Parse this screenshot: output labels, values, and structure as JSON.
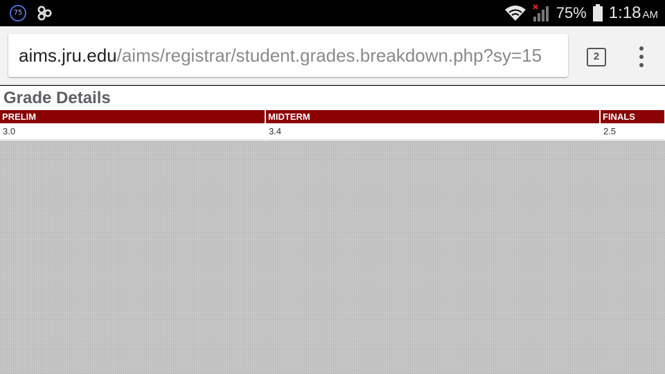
{
  "status_bar": {
    "notification_badge": "75",
    "battery_percent": "75%",
    "time": "1:18",
    "am_pm": "AM",
    "icons": [
      "notification-75-icon",
      "link-app-icon",
      "wifi-icon",
      "cellular-no-signal-icon",
      "battery-icon"
    ]
  },
  "browser": {
    "url_host": "aims.jru.edu",
    "url_path": "/aims/registrar/student.grades.breakdown.php?sy=15",
    "tab_count": "2"
  },
  "page": {
    "title": "Grade Details",
    "columns": [
      "PRELIM",
      "MIDTERM",
      "FINALS"
    ],
    "rows": [
      [
        "3.0",
        "3.4",
        "2.5"
      ]
    ]
  },
  "colors": {
    "header_bg": "#8b0000",
    "title_text": "#5f6064"
  }
}
